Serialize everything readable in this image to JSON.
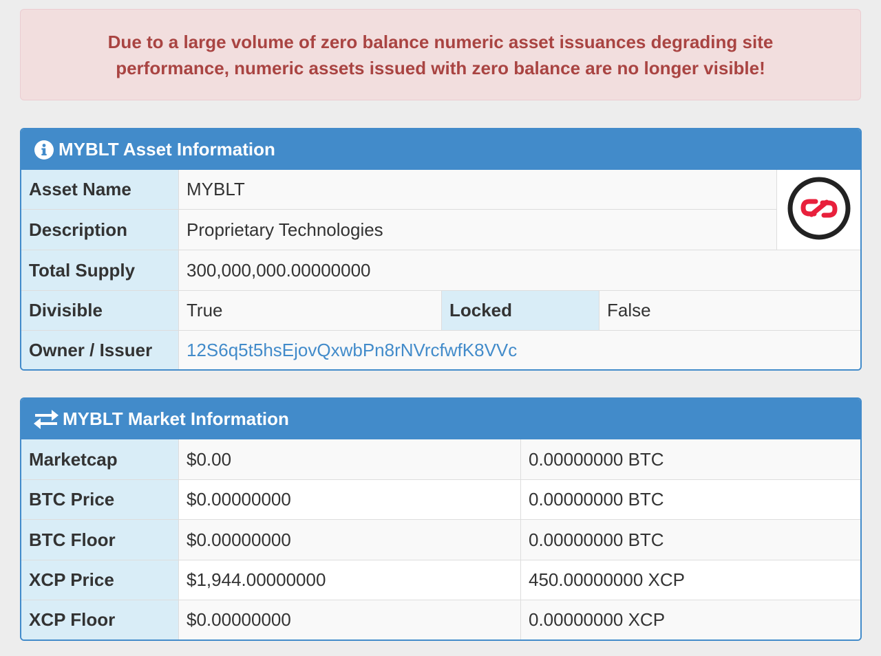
{
  "alert": {
    "message": "Due to a large volume of zero balance numeric asset issuances degrading site performance, numeric assets issued with zero balance are no longer visible!"
  },
  "asset_panel": {
    "title": "MYBLT Asset Information",
    "icon": "info-circle-icon",
    "logo_icon": "counterparty-logo-icon",
    "rows": {
      "asset_name": {
        "label": "Asset Name",
        "value": "MYBLT"
      },
      "description": {
        "label": "Description",
        "value": "Proprietary Technologies"
      },
      "total_supply": {
        "label": "Total Supply",
        "value": "300,000,000.00000000"
      },
      "divisible": {
        "label": "Divisible",
        "value": "True"
      },
      "locked": {
        "label": "Locked",
        "value": "False"
      },
      "owner": {
        "label": "Owner / Issuer",
        "value": "12S6q5t5hsEjovQxwbPn8rNVrcfwfK8VVc"
      }
    }
  },
  "market_panel": {
    "title": "MYBLT Market Information",
    "icon": "exchange-arrows-icon",
    "rows": [
      {
        "label": "Marketcap",
        "usd": "$0.00",
        "native": "0.00000000 BTC"
      },
      {
        "label": "BTC Price",
        "usd": "$0.00000000",
        "native": "0.00000000 BTC"
      },
      {
        "label": "BTC Floor",
        "usd": "$0.00000000",
        "native": "0.00000000 BTC"
      },
      {
        "label": "XCP Price",
        "usd": "$1,944.00000000",
        "native": "450.00000000 XCP"
      },
      {
        "label": "XCP Floor",
        "usd": "$0.00000000",
        "native": "0.00000000 XCP"
      }
    ]
  },
  "colors": {
    "panel_primary": "#428bca",
    "label_bg": "#d9edf7",
    "alert_bg": "#f2dede",
    "alert_text": "#a94442",
    "logo_red": "#e8203c"
  }
}
